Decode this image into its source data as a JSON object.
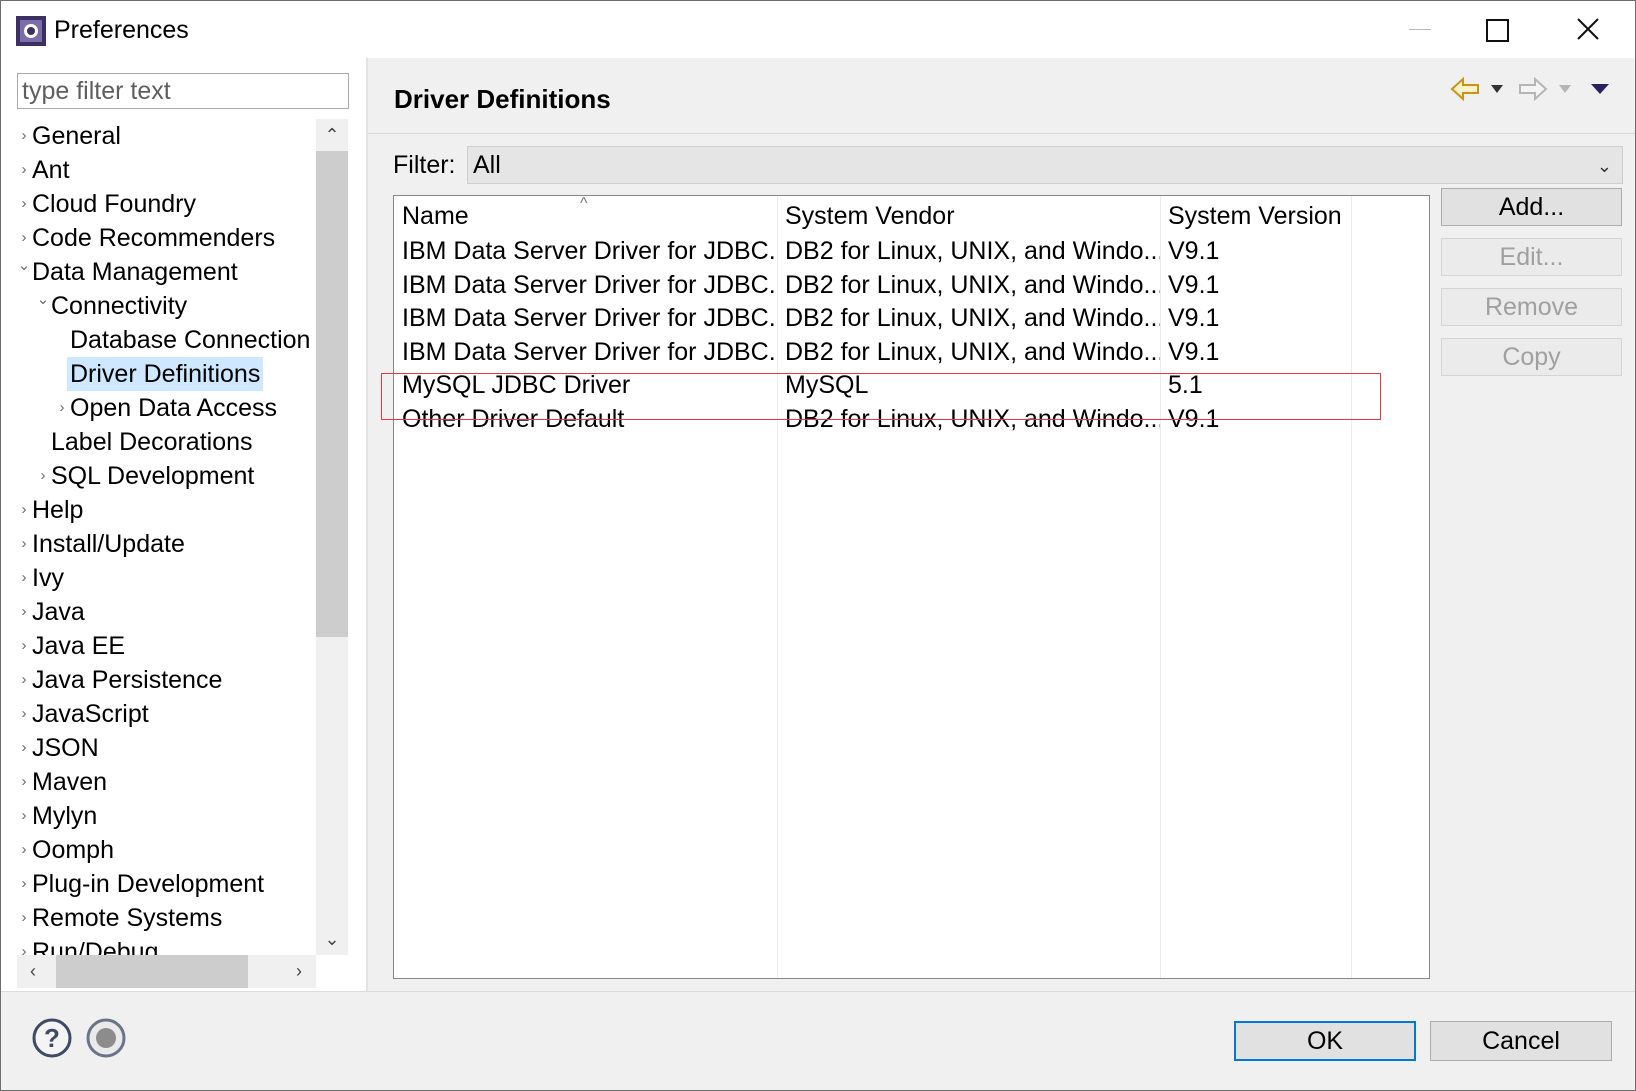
{
  "window": {
    "title": "Preferences"
  },
  "left": {
    "filter_placeholder": "type filter text",
    "tree": [
      {
        "label": "General",
        "arrow": "›",
        "level": 0
      },
      {
        "label": "Ant",
        "arrow": "›",
        "level": 0
      },
      {
        "label": "Cloud Foundry",
        "arrow": "›",
        "level": 0
      },
      {
        "label": "Code Recommenders",
        "arrow": "›",
        "level": 0
      },
      {
        "label": "Data Management",
        "arrow": "⌄",
        "level": 0
      },
      {
        "label": "Connectivity",
        "arrow": "⌄",
        "level": 1
      },
      {
        "label": "Database Connection",
        "arrow": "",
        "level": 2
      },
      {
        "label": "Driver Definitions",
        "arrow": "",
        "level": 2,
        "selected": true
      },
      {
        "label": "Open Data Access",
        "arrow": "›",
        "level": 2
      },
      {
        "label": "Label Decorations",
        "arrow": "",
        "level": 1
      },
      {
        "label": "SQL Development",
        "arrow": "›",
        "level": 1
      },
      {
        "label": "Help",
        "arrow": "›",
        "level": 0
      },
      {
        "label": "Install/Update",
        "arrow": "›",
        "level": 0
      },
      {
        "label": "Ivy",
        "arrow": "›",
        "level": 0
      },
      {
        "label": "Java",
        "arrow": "›",
        "level": 0
      },
      {
        "label": "Java EE",
        "arrow": "›",
        "level": 0
      },
      {
        "label": "Java Persistence",
        "arrow": "›",
        "level": 0
      },
      {
        "label": "JavaScript",
        "arrow": "›",
        "level": 0
      },
      {
        "label": "JSON",
        "arrow": "›",
        "level": 0
      },
      {
        "label": "Maven",
        "arrow": "›",
        "level": 0
      },
      {
        "label": "Mylyn",
        "arrow": "›",
        "level": 0
      },
      {
        "label": "Oomph",
        "arrow": "›",
        "level": 0
      },
      {
        "label": "Plug-in Development",
        "arrow": "›",
        "level": 0
      },
      {
        "label": "Remote Systems",
        "arrow": "›",
        "level": 0
      },
      {
        "label": "Run/Debug",
        "arrow": "›",
        "level": 0
      }
    ]
  },
  "page": {
    "title": "Driver Definitions",
    "filter_label": "Filter:",
    "filter_value": "All",
    "columns": [
      "Name",
      "System Vendor",
      "System Version"
    ],
    "rows": [
      [
        "IBM Data Server Driver for JDBC...",
        "DB2 for Linux, UNIX, and Windo...",
        "V9.1"
      ],
      [
        "IBM Data Server Driver for JDBC...",
        "DB2 for Linux, UNIX, and Windo...",
        "V9.1"
      ],
      [
        "IBM Data Server Driver for JDBC...",
        "DB2 for Linux, UNIX, and Windo...",
        "V9.1"
      ],
      [
        "IBM Data Server Driver for JDBC...",
        "DB2 for Linux, UNIX, and Windo...",
        "V9.1"
      ],
      [
        "MySQL JDBC Driver",
        "MySQL",
        "5.1"
      ],
      [
        "Other Driver Default",
        "DB2 for Linux, UNIX, and Windo...",
        "V9.1"
      ]
    ],
    "buttons": {
      "add": "Add...",
      "edit": "Edit...",
      "remove": "Remove",
      "copy": "Copy"
    }
  },
  "footer": {
    "ok": "OK",
    "cancel": "Cancel"
  },
  "colors": {
    "selection": "#cde8ff",
    "highlight_box": "#e8383d",
    "default_button_border": "#0078d7"
  }
}
